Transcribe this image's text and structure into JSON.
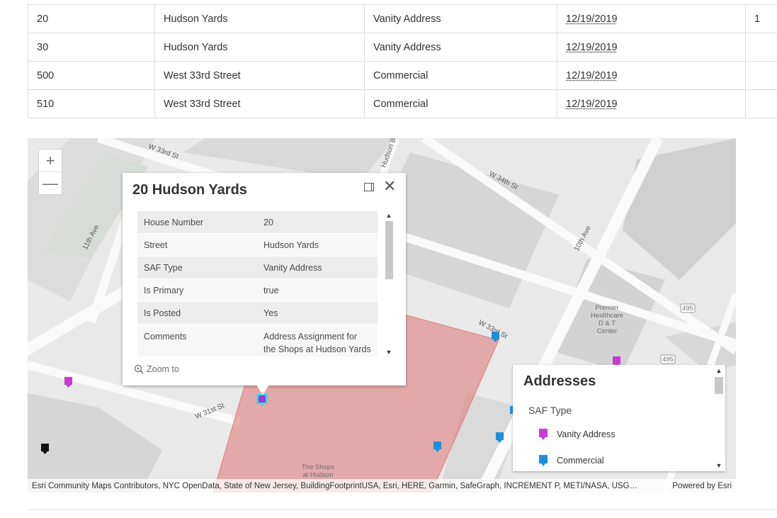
{
  "table": {
    "rows": [
      {
        "house": "20",
        "street": "Hudson Yards",
        "saf": "Vanity Address",
        "date": "12/19/2019",
        "extra": "1"
      },
      {
        "house": "30",
        "street": "Hudson Yards",
        "saf": "Vanity Address",
        "date": "12/19/2019",
        "extra": ""
      },
      {
        "house": "500",
        "street": "West 33rd Street",
        "saf": "Commercial",
        "date": "12/19/2019",
        "extra": ""
      },
      {
        "house": "510",
        "street": "West 33rd Street",
        "saf": "Commercial",
        "date": "12/19/2019",
        "extra": ""
      }
    ]
  },
  "map": {
    "zoom_in": "+",
    "zoom_out": "—",
    "street_labels": [
      "W 33rd St",
      "Hudson Bl",
      "W 34th St",
      "11th Ave",
      "10th Ave",
      "W 33rd St",
      "W 31st St"
    ],
    "area_labels": [
      "Premier",
      "Healthcare",
      "D & T",
      "Center",
      "The Shops",
      "at Hudson"
    ],
    "shield_labels": [
      "495",
      "495"
    ],
    "attribution": "Esri Community Maps Contributors, NYC OpenData, State of New Jersey, BuildingFootprintUSA, Esri, HERE, Garmin, SafeGraph, INCREMENT P, METI/NASA, USG…",
    "powered_by": "Powered by Esri",
    "colors": {
      "vanity": "#c83ad6",
      "commercial": "#1f8fdc",
      "highlight": "#e07d7d"
    }
  },
  "popup": {
    "title": "20 Hudson Yards",
    "fields": [
      {
        "label": "House Number",
        "value": "20"
      },
      {
        "label": "Street",
        "value": "Hudson Yards"
      },
      {
        "label": "SAF Type",
        "value": "Vanity Address"
      },
      {
        "label": "Is Primary",
        "value": "true"
      },
      {
        "label": "Is Posted",
        "value": "Yes"
      },
      {
        "label": "Comments",
        "value": "Address Assignment for the Shops at Hudson Yards"
      }
    ],
    "zoom_to": "Zoom to"
  },
  "legend": {
    "title": "Addresses",
    "subtitle": "SAF Type",
    "items": [
      {
        "label": "Vanity Address",
        "icon": "vanity-pin-icon"
      },
      {
        "label": "Commercial",
        "icon": "commercial-pin-icon"
      }
    ]
  }
}
